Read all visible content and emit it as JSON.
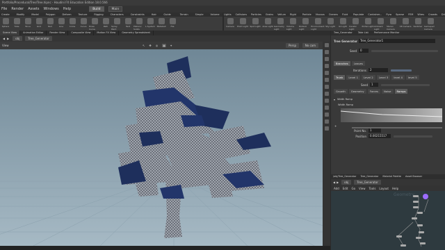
{
  "window": {
    "title": "Portfolio/Procedural/Tree/Tree.hipnc - Houdini FX Education Edition 18.0.566"
  },
  "menubar": {
    "items": [
      "File",
      "Render",
      "Assets",
      "Windows",
      "Help"
    ],
    "build_label": "Build",
    "main_label": "Main"
  },
  "shelf_tabs_left": [
    "Create",
    "Modify",
    "Model",
    "Polygon",
    "Deform",
    "Texture",
    "Rigging",
    "Characters",
    "Constraints",
    "Hair Utils",
    "Guide Process",
    "Terrain FX",
    "Simple FX",
    "Volume"
  ],
  "shelf_tools_left": [
    "Sphere",
    "Tube",
    "Torus",
    "Grid",
    "Null",
    "Line",
    "Circle",
    "Curve",
    "Draw Curve",
    "Path",
    "Spray Paint",
    "Text",
    "Platonic Solids",
    "L-System",
    "Metaball",
    "File"
  ],
  "shelf_tabs_right": [
    "Lights and...",
    "Collisions",
    "Particles",
    "Grains",
    "Vellum",
    "Rigid Bodies",
    "Particle Fl...",
    "Viscous Fl...",
    "Oceans",
    "Fluid Con...",
    "Populate C...",
    "Container...",
    "Pyro FX",
    "Sparse Py...",
    "FEM",
    "Wires",
    "Crowds",
    "Drive Sim..."
  ],
  "shelf_tools_right": [
    "Camera",
    "Point Light",
    "Spot Light",
    "Area Light",
    "Geometry Light",
    "Volume Light",
    "Distant Light",
    "Environment Light",
    "Sky Light",
    "GI Light",
    "Caustic Light",
    "Portal Light",
    "Ambient Light",
    "Stereo Camera",
    "VR Camera",
    "Switcher",
    "Gamepad Camera"
  ],
  "left_tabs": [
    "Scene View",
    "Animation Editor",
    "Render View",
    "Composite View",
    "Motion FX View",
    "Geometry Spreadsheet"
  ],
  "path": {
    "root": "obj",
    "node": "Tree_Generator"
  },
  "viewport": {
    "label": "View",
    "persp": "Persp",
    "cam": "No cam",
    "bg": "#8ea6b5"
  },
  "right_tabs": [
    "Tree_Generator",
    "Take List",
    "Performance Monitor"
  ],
  "params": {
    "node_type": "Tree Generator",
    "node_name": "Tree_Generator1",
    "seed_label": "Seed",
    "seed_value": "0",
    "section_tabs": [
      "Branches",
      "Leaves"
    ],
    "iterations_label": "Iterations",
    "iterations_value": "2",
    "level_tabs": [
      "Trunk",
      "Level 1",
      "Level 2",
      "Level 3",
      "level 4",
      "level 5"
    ],
    "seed2_label": "Seed",
    "seed2_value": "1",
    "sub_tabs": [
      "Growth",
      "Geometry",
      "Forces",
      "Noise",
      "Ramps"
    ],
    "ramp_label": "Width Ramp",
    "point_no_label": "Point No.",
    "point_no_value": "1",
    "position_label": "Position",
    "position_value": "0.00215517"
  },
  "net_tabs": [
    "/obj/Tree_Generator",
    "Tree_Generator",
    "Material Palette",
    "Asset Browser"
  ],
  "net_menu": [
    "Add",
    "Edit",
    "Go",
    "View",
    "Tools",
    "Layout",
    "Help"
  ],
  "net_watermark": "Geometry"
}
